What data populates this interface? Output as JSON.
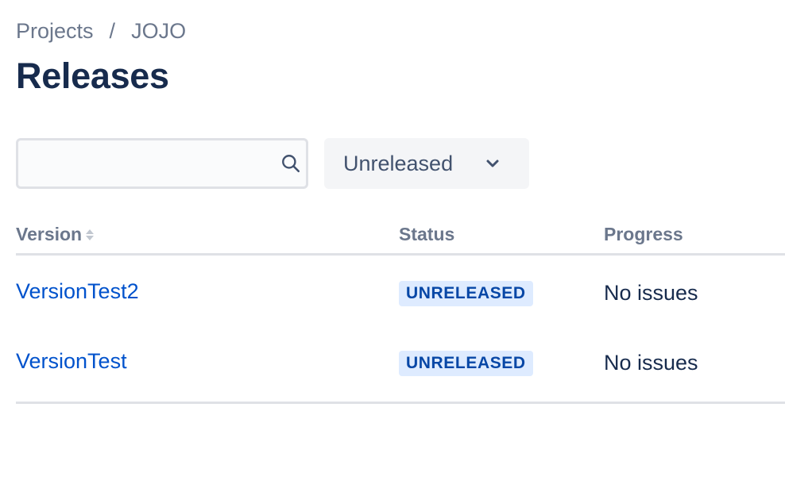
{
  "breadcrumb": {
    "items": [
      "Projects",
      "JOJO"
    ],
    "separator": "/"
  },
  "page": {
    "title": "Releases"
  },
  "search": {
    "value": "",
    "placeholder": ""
  },
  "filter": {
    "selected": "Unreleased"
  },
  "table": {
    "columns": {
      "version": "Version",
      "status": "Status",
      "progress": "Progress"
    },
    "rows": [
      {
        "version": "VersionTest2",
        "status": "UNRELEASED",
        "progress": "No issues"
      },
      {
        "version": "VersionTest",
        "status": "UNRELEASED",
        "progress": "No issues"
      }
    ]
  },
  "colors": {
    "link": "#0052cc",
    "lozenge_bg": "#deebff",
    "lozenge_text": "#0747a6",
    "title": "#172b4d",
    "muted": "#6b778c"
  },
  "icons": {
    "search": "search-icon",
    "chevron": "chevron-down-icon",
    "sort": "sort-icon"
  }
}
